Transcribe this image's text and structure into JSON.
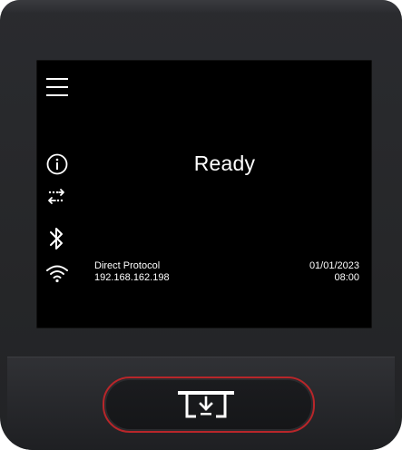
{
  "screen": {
    "status_text": "Ready",
    "protocol_label": "Direct Protocol",
    "ip_address": "192.168.162.198",
    "date": "01/01/2023",
    "time": "08:00"
  },
  "icons": {
    "menu": "menu-icon",
    "info": "info-icon",
    "network": "network-transfer-icon",
    "bluetooth": "bluetooth-icon",
    "wifi": "wifi-icon",
    "feed": "paper-feed-icon"
  },
  "colors": {
    "screen_background": "#000000",
    "text": "#ffffff",
    "button_ring": "#b8262a",
    "device_body": "#2a2b2f"
  }
}
